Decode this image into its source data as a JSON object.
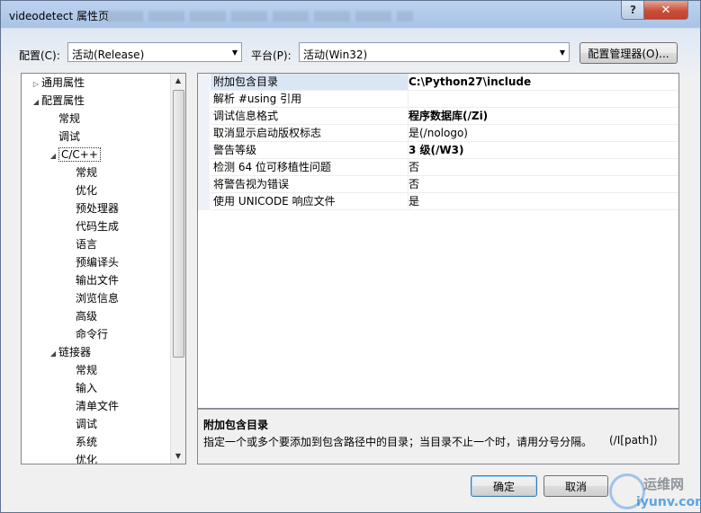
{
  "window": {
    "title": "videodetect 属性页",
    "help_glyph": "?",
    "close_glyph": "✕"
  },
  "toolbar": {
    "config_label": "配置(C):",
    "config_value": "活动(Release)",
    "platform_label": "平台(P):",
    "platform_value": "活动(Win32)",
    "config_manager_label": "配置管理器(O)..."
  },
  "tree": {
    "items": [
      {
        "label": "通用属性",
        "expander": "▷"
      },
      {
        "label": "配置属性",
        "expander": "◢"
      },
      {
        "label": "常规",
        "expander": ""
      },
      {
        "label": "调试",
        "expander": ""
      },
      {
        "label": "C/C++",
        "expander": "◢"
      },
      {
        "label": "常规",
        "expander": ""
      },
      {
        "label": "优化",
        "expander": ""
      },
      {
        "label": "预处理器",
        "expander": ""
      },
      {
        "label": "代码生成",
        "expander": ""
      },
      {
        "label": "语言",
        "expander": ""
      },
      {
        "label": "预编译头",
        "expander": ""
      },
      {
        "label": "输出文件",
        "expander": ""
      },
      {
        "label": "浏览信息",
        "expander": ""
      },
      {
        "label": "高级",
        "expander": ""
      },
      {
        "label": "命令行",
        "expander": ""
      },
      {
        "label": "链接器",
        "expander": "◢"
      },
      {
        "label": "常规",
        "expander": ""
      },
      {
        "label": "输入",
        "expander": ""
      },
      {
        "label": "清单文件",
        "expander": ""
      },
      {
        "label": "调试",
        "expander": ""
      },
      {
        "label": "系统",
        "expander": ""
      },
      {
        "label": "优化",
        "expander": ""
      }
    ],
    "selected_label": "C/C++",
    "scroll_up": "▲",
    "scroll_down": "▼"
  },
  "grid": {
    "rows": [
      {
        "name": "附加包含目录",
        "value": "C:\\Python27\\include"
      },
      {
        "name": "解析 #using 引用",
        "value": ""
      },
      {
        "name": "调试信息格式",
        "value": "程序数据库(/Zi)"
      },
      {
        "name": "取消显示启动版权标志",
        "value": "是(/nologo)"
      },
      {
        "name": "警告等级",
        "value": "3 级(/W3)"
      },
      {
        "name": "检测 64 位可移植性问题",
        "value": "否"
      },
      {
        "name": "将警告视为错误",
        "value": "否"
      },
      {
        "name": "使用 UNICODE 响应文件",
        "value": "是"
      }
    ]
  },
  "description": {
    "title": "附加包含目录",
    "text": "指定一个或多个要添加到包含路径中的目录；当目录不止一个时，请用分号分隔。",
    "switch": "(/I[path])"
  },
  "footer": {
    "ok_label": "确定",
    "cancel_label": "取消"
  },
  "watermark": {
    "top_text": "运维网",
    "bottom_text": "iyunv.com"
  }
}
